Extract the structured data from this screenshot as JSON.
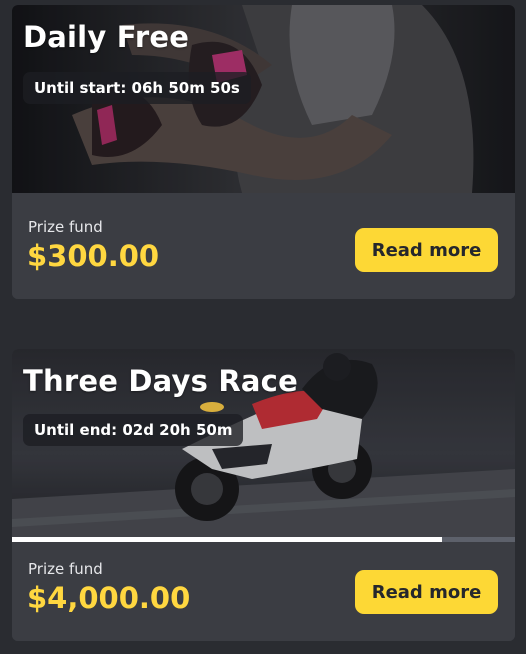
{
  "tournaments": [
    {
      "title": "Daily Free",
      "timer": "Until start: 06h 50m 50s",
      "prize_label": "Prize fund",
      "prize_value": "$300.00",
      "button_label": "Read more"
    },
    {
      "title": "Three Days Race",
      "timer": "Until end: 02d 20h 50m",
      "progress": 0.855,
      "prize_label": "Prize fund",
      "prize_value": "$4,000.00",
      "button_label": "Read more"
    }
  ],
  "colors": {
    "page_background": "#2a2c31",
    "card_background": "#3b3d43",
    "accent_yellow": "#fdd835",
    "prize_text": "#ffd740"
  }
}
